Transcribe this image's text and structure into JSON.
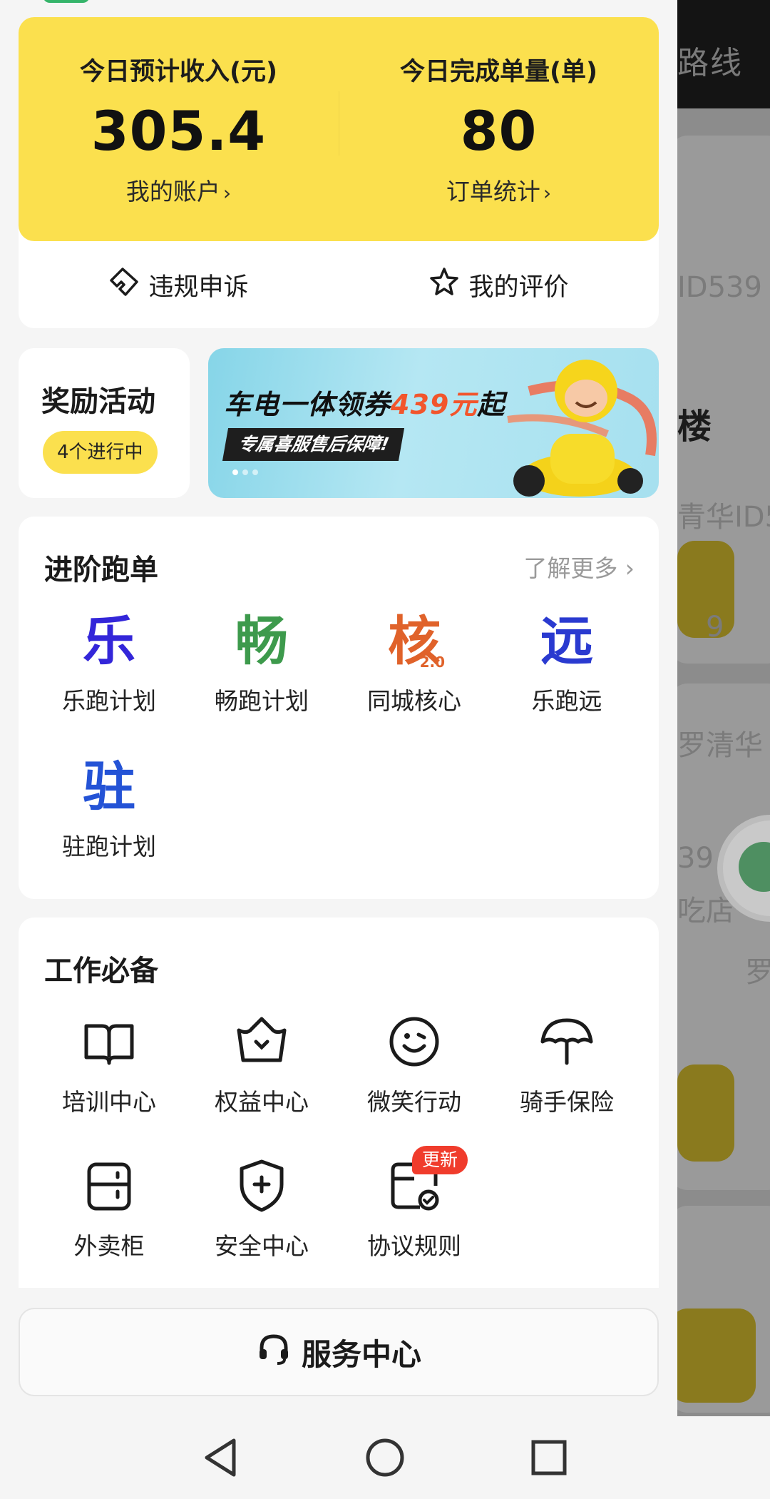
{
  "background": {
    "topbar_text": "路线",
    "texts": [
      "ID539",
      "楼",
      "青华ID5",
      "9",
      "罗清华",
      "39",
      "吃店",
      "罗清"
    ]
  },
  "income": {
    "left": {
      "label": "今日预计收入(元)",
      "value": "305.4",
      "link": "我的账户"
    },
    "right": {
      "label": "今日完成单量(单)",
      "value": "80",
      "link": "订单统计"
    },
    "chevron": "›"
  },
  "quick_actions": [
    {
      "label": "违规申诉",
      "icon": "appeal-icon"
    },
    {
      "label": "我的评价",
      "icon": "star-icon"
    }
  ],
  "reward": {
    "title": "奖励活动",
    "badge": "4个进行中"
  },
  "banner": {
    "title_prefix": "车电一体领券",
    "title_highlight": "439元",
    "title_suffix": "起",
    "subtitle": "专属喜服售后保障!"
  },
  "advanced": {
    "title": "进阶跑单",
    "learn_more": "了解更多 ›",
    "items": [
      {
        "char": "乐",
        "label": "乐跑计划",
        "color": "#3326d9"
      },
      {
        "char": "畅",
        "label": "畅跑计划",
        "color": "#3d9a4c"
      },
      {
        "char": "核",
        "sup": "2.0",
        "label": "同城核心",
        "color": "#e0622a"
      },
      {
        "char": "远",
        "label": "乐跑远",
        "color": "#2a3ad0"
      },
      {
        "char": "驻",
        "label": "驻跑计划",
        "color": "#2453d6"
      }
    ]
  },
  "work": {
    "title": "工作必备",
    "items": [
      {
        "label": "培训中心",
        "icon": "book-icon"
      },
      {
        "label": "权益中心",
        "icon": "crown-icon"
      },
      {
        "label": "微笑行动",
        "icon": "smile-icon"
      },
      {
        "label": "骑手保险",
        "icon": "umbrella-icon"
      },
      {
        "label": "外卖柜",
        "icon": "locker-icon"
      },
      {
        "label": "安全中心",
        "icon": "shield-icon"
      },
      {
        "label": "协议规则",
        "icon": "agreement-icon"
      }
    ],
    "update_badge": "更新"
  },
  "service": {
    "label": "服务中心",
    "icon": "headset-icon"
  },
  "nav": [
    "back-icon",
    "home-icon",
    "recents-icon"
  ],
  "colors": {
    "accent_yellow": "#fbe04e",
    "badge_red": "#f03c2c"
  }
}
